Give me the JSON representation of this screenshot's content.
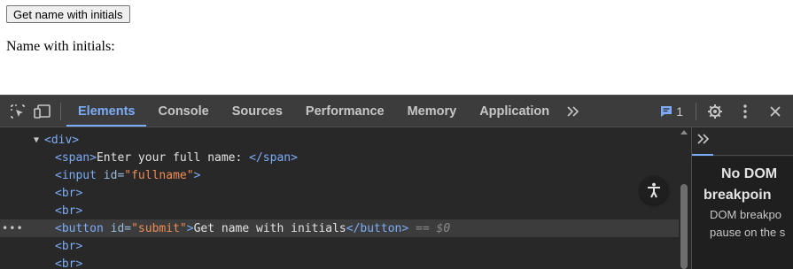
{
  "page": {
    "button_label": "Get name with initials",
    "result_label": "Name with initials:"
  },
  "devtools": {
    "tabs": [
      {
        "label": "Elements",
        "active": true
      },
      {
        "label": "Console",
        "active": false
      },
      {
        "label": "Sources",
        "active": false
      },
      {
        "label": "Performance",
        "active": false
      },
      {
        "label": "Memory",
        "active": false
      },
      {
        "label": "Application",
        "active": false
      }
    ],
    "more_tabs_icon": "chevron-double-right-icon",
    "issues_count": "1",
    "icons": [
      "inspect-element-icon",
      "device-toolbar-icon",
      "issues-icon",
      "settings-gear-icon",
      "more-vertical-icon",
      "close-icon",
      "accessibility-icon"
    ],
    "colors": {
      "accent": "#7cacf8",
      "tag": "#7cacf8",
      "attr_value": "#f28b54",
      "panel_bg": "#282828",
      "toolbar_bg": "#3c3c3c"
    }
  },
  "dom_tree": {
    "lines": [
      {
        "tag_open": "<div>"
      },
      {
        "tag_open": "<span>",
        "text": "Enter your full name: ",
        "tag_close": "</span>"
      },
      {
        "tag_open": "<input",
        "attr": " id=",
        "value": "\"fullname\"",
        "tag_end": ">"
      },
      {
        "tag_open": "<br>"
      },
      {
        "tag_open": "<br>"
      },
      {
        "tag_open": "<button",
        "attr": " id=",
        "value": "\"submit\"",
        "tag_end": ">",
        "text": "Get name with initials",
        "tag_close": "</button>",
        "marker": " == $0"
      },
      {
        "tag_open": "<br>"
      },
      {
        "tag_open": "<br>"
      }
    ]
  },
  "side_pane": {
    "title_line1": "No DOM",
    "title_line2": "breakpoin",
    "text_line1": "DOM breakpo",
    "text_line2": "pause on the s"
  }
}
